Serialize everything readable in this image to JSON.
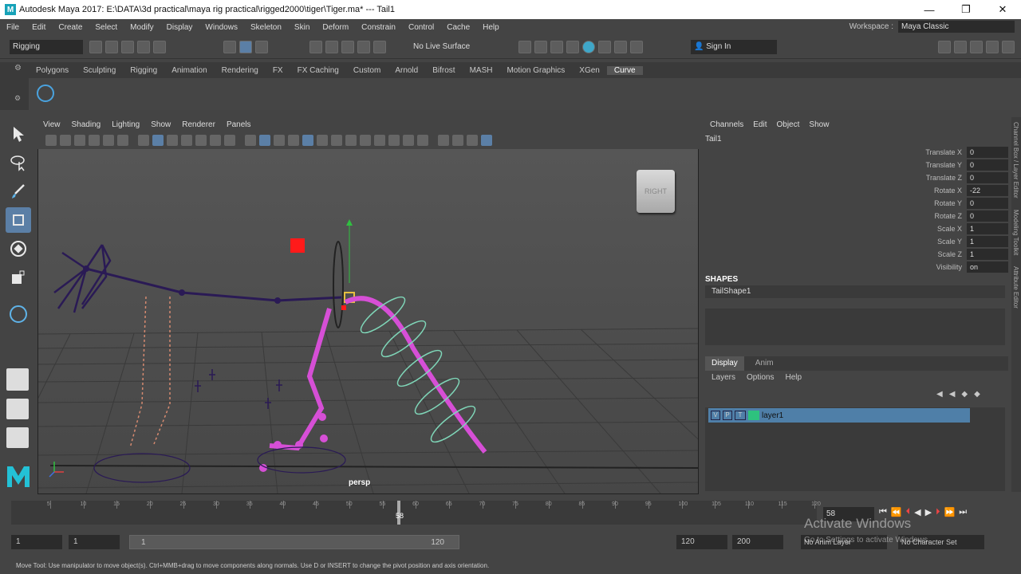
{
  "titlebar": {
    "title": "Autodesk Maya 2017: E:\\DATA\\3d practical\\maya rig practical\\rigged2000\\tiger\\Tiger.ma*   ---   Tail1",
    "minimize": "—",
    "maximize": "❐",
    "close": "✕"
  },
  "menubar": {
    "items": [
      "File",
      "Edit",
      "Create",
      "Select",
      "Modify",
      "Display",
      "Windows",
      "Skeleton",
      "Skin",
      "Deform",
      "Constrain",
      "Control",
      "Cache",
      "Help"
    ],
    "workspace_label": "Workspace :",
    "workspace_value": "Maya Classic"
  },
  "statusline": {
    "mode": "Rigging",
    "live_surface": "No Live Surface",
    "sign_in": "Sign In"
  },
  "shelf": {
    "tabs": [
      "Polygons",
      "Sculpting",
      "Rigging",
      "Animation",
      "Rendering",
      "FX",
      "FX Caching",
      "Custom",
      "Arnold",
      "Bifrost",
      "MASH",
      "Motion Graphics",
      "XGen",
      "Curve"
    ],
    "active_tab": "Curve"
  },
  "viewport": {
    "menu": [
      "View",
      "Shading",
      "Lighting",
      "Show",
      "Renderer",
      "Panels"
    ],
    "camera_label": "persp",
    "viewcube_label": "RIGHT"
  },
  "channelbox": {
    "menu": [
      "Channels",
      "Edit",
      "Object",
      "Show"
    ],
    "object_name": "Tail1",
    "attributes": [
      {
        "name": "Translate X",
        "value": "0"
      },
      {
        "name": "Translate Y",
        "value": "0"
      },
      {
        "name": "Translate Z",
        "value": "0"
      },
      {
        "name": "Rotate X",
        "value": "-22"
      },
      {
        "name": "Rotate Y",
        "value": "0"
      },
      {
        "name": "Rotate Z",
        "value": "0"
      },
      {
        "name": "Scale X",
        "value": "1"
      },
      {
        "name": "Scale Y",
        "value": "1"
      },
      {
        "name": "Scale Z",
        "value": "1"
      },
      {
        "name": "Visibility",
        "value": "on"
      }
    ],
    "shapes_header": "SHAPES",
    "shape_name": "TailShape1"
  },
  "layereditor": {
    "tabs": [
      "Display",
      "Anim"
    ],
    "menu": [
      "Layers",
      "Options",
      "Help"
    ],
    "layer_v": "V",
    "layer_p": "P",
    "layer_type": "T",
    "layer_name": "layer1"
  },
  "sidetabs": [
    "Channel Box / Layer Editor",
    "Modeling Toolkit",
    "Attribute Editor"
  ],
  "timeslider": {
    "ticks": [
      "5",
      "10",
      "15",
      "20",
      "25",
      "30",
      "35",
      "40",
      "45",
      "50",
      "55",
      "60",
      "65",
      "70",
      "75",
      "80",
      "85",
      "90",
      "95",
      "100",
      "105",
      "110",
      "115",
      "120"
    ],
    "current_frame_marker": "58",
    "current_frame_field": "58"
  },
  "rangeslider": {
    "start": "1",
    "playback_start": "1",
    "range_start_label": "1",
    "range_end_label": "120",
    "playback_end": "120",
    "end": "200",
    "anim_layer": "No Anim Layer",
    "char_set": "No Character Set"
  },
  "helpline": {
    "text": "Move Tool: Use manipulator to move object(s). Ctrl+MMB+drag to move components along normals. Use D or INSERT to change the pivot position and axis orientation."
  },
  "watermark": {
    "line1": "Activate Windows",
    "line2": "Go to Settings to activate Windows."
  },
  "colors": {
    "accent": "#5b7fa6",
    "layer_row": "#4f7fa8",
    "layer_color": "#2ec27e",
    "joint_purple": "#2a1a55",
    "curve_magenta": "#d64fd6",
    "ik_ring": "#7fd6b8",
    "locator_red": "#ff1a1a"
  }
}
